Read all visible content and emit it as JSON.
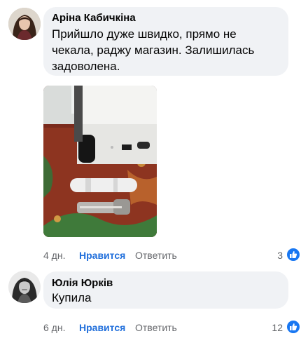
{
  "comments": [
    {
      "author": "Аріна Кабичкіна",
      "text_lines": [
        "Прийшло дуже швидко, прямо не",
        "чекала, раджу магазин. Залишилась",
        "задоволена."
      ],
      "time": "4 дн.",
      "like_label": "Нравится",
      "reply_label": "Ответить",
      "reaction_count": "3"
    },
    {
      "author": "Юлія Юрків",
      "text_lines": [
        "Купила"
      ],
      "time": "6 дн.",
      "like_label": "Нравится",
      "reply_label": "Ответить",
      "reaction_count": "12"
    }
  ],
  "colors": {
    "bubble": "#f0f2f5",
    "link": "#216fdb",
    "meta": "#65676b",
    "like_badge": "#1877f2"
  },
  "icons": {
    "like_badge": "thumbs-up-icon"
  }
}
